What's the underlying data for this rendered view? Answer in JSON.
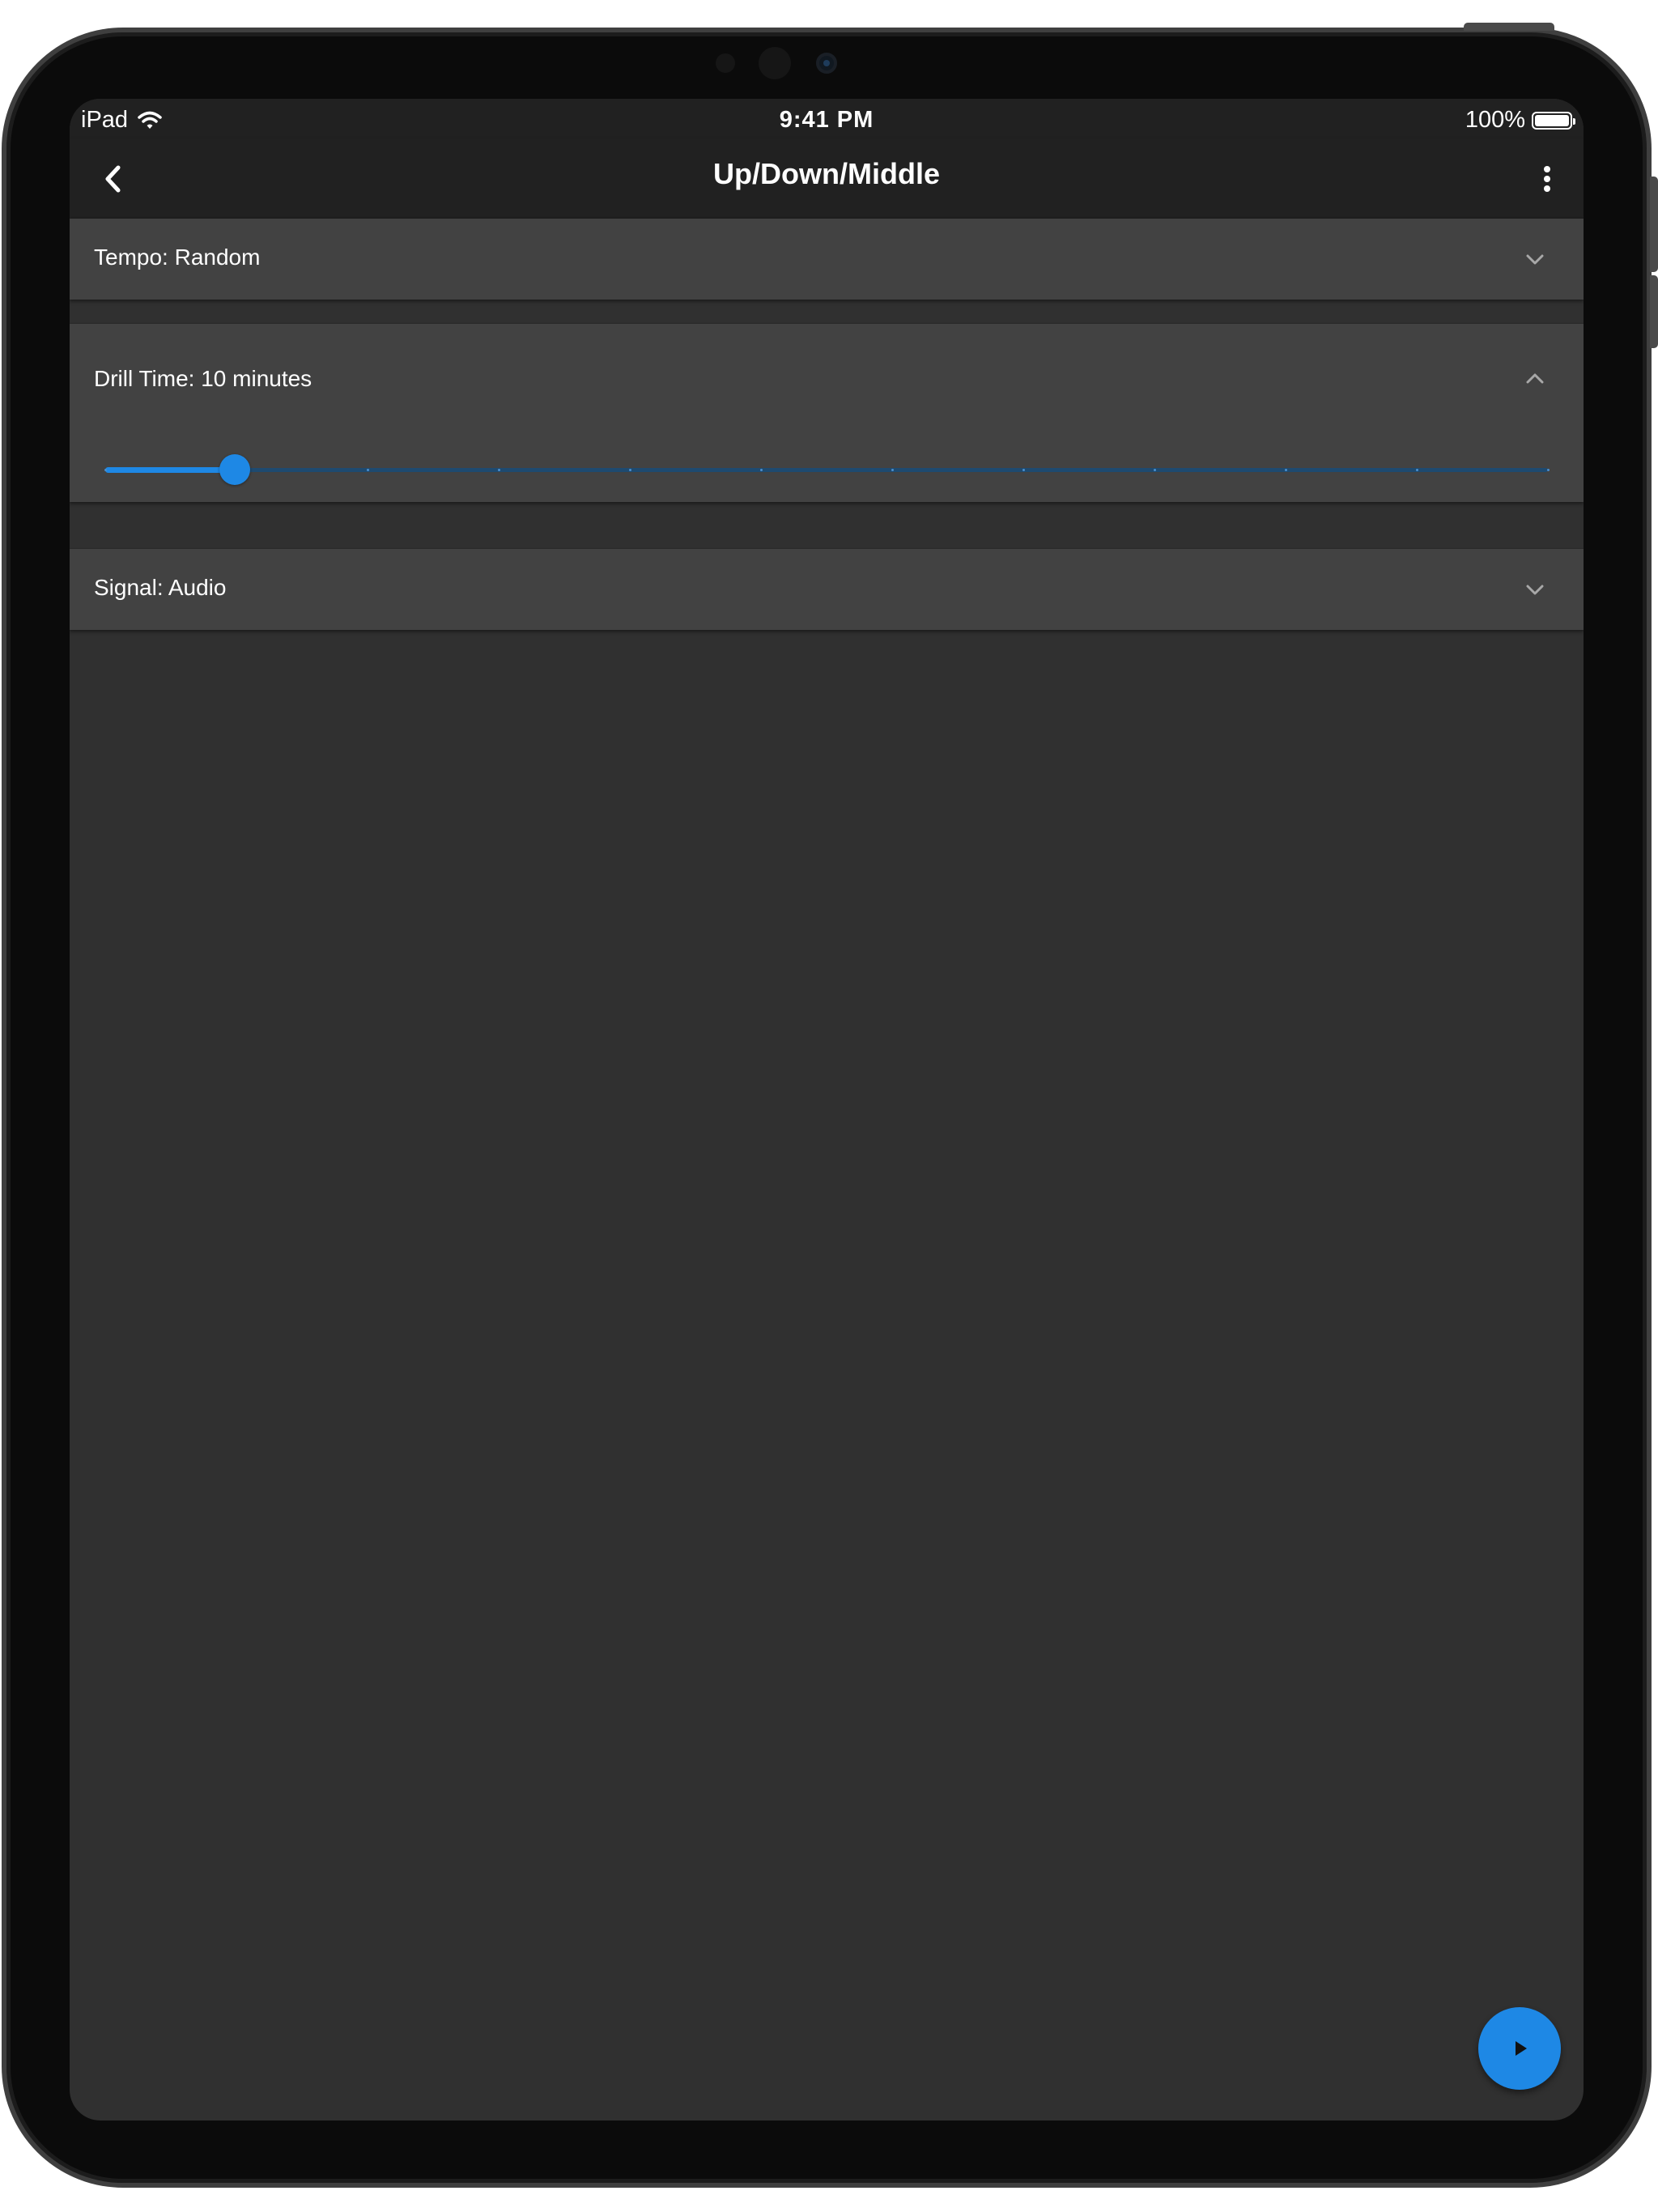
{
  "status_bar": {
    "device": "iPad",
    "time": "9:41 PM",
    "battery": "100%",
    "battery_level": 1.0
  },
  "app_bar": {
    "title": "Up/Down/Middle",
    "back_icon": "chevron-left-icon",
    "menu_icon": "more-vertical-icon"
  },
  "panels": [
    {
      "label": "Tempo: Random",
      "expanded": false,
      "icon": "chevron-down-icon"
    },
    {
      "label": "Drill Time: 10 minutes",
      "expanded": true,
      "icon": "chevron-up-icon"
    },
    {
      "label": "Signal: Audio",
      "expanded": false,
      "icon": "chevron-down-icon"
    }
  ],
  "drill_time_slider": {
    "value_fraction": 0.09,
    "divisions": 11
  },
  "fab": {
    "icon": "play-icon"
  },
  "colors": {
    "accent": "#1e88e5",
    "background": "#303030",
    "app_bar": "#212121",
    "panel": "#424242"
  }
}
